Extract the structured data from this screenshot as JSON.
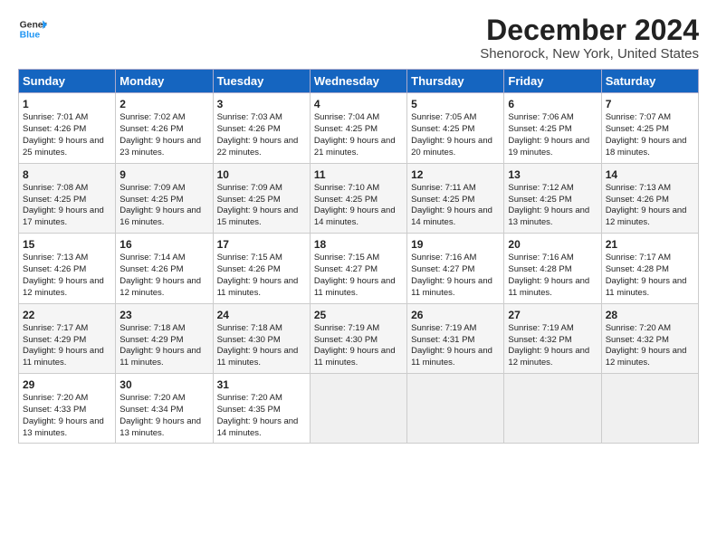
{
  "header": {
    "logo_line1": "General",
    "logo_line2": "Blue",
    "title": "December 2024",
    "subtitle": "Shenorock, New York, United States"
  },
  "days_of_week": [
    "Sunday",
    "Monday",
    "Tuesday",
    "Wednesday",
    "Thursday",
    "Friday",
    "Saturday"
  ],
  "weeks": [
    [
      {
        "day": 1,
        "sunrise": "Sunrise: 7:01 AM",
        "sunset": "Sunset: 4:26 PM",
        "daylight": "Daylight: 9 hours and 25 minutes."
      },
      {
        "day": 2,
        "sunrise": "Sunrise: 7:02 AM",
        "sunset": "Sunset: 4:26 PM",
        "daylight": "Daylight: 9 hours and 23 minutes."
      },
      {
        "day": 3,
        "sunrise": "Sunrise: 7:03 AM",
        "sunset": "Sunset: 4:26 PM",
        "daylight": "Daylight: 9 hours and 22 minutes."
      },
      {
        "day": 4,
        "sunrise": "Sunrise: 7:04 AM",
        "sunset": "Sunset: 4:25 PM",
        "daylight": "Daylight: 9 hours and 21 minutes."
      },
      {
        "day": 5,
        "sunrise": "Sunrise: 7:05 AM",
        "sunset": "Sunset: 4:25 PM",
        "daylight": "Daylight: 9 hours and 20 minutes."
      },
      {
        "day": 6,
        "sunrise": "Sunrise: 7:06 AM",
        "sunset": "Sunset: 4:25 PM",
        "daylight": "Daylight: 9 hours and 19 minutes."
      },
      {
        "day": 7,
        "sunrise": "Sunrise: 7:07 AM",
        "sunset": "Sunset: 4:25 PM",
        "daylight": "Daylight: 9 hours and 18 minutes."
      }
    ],
    [
      {
        "day": 8,
        "sunrise": "Sunrise: 7:08 AM",
        "sunset": "Sunset: 4:25 PM",
        "daylight": "Daylight: 9 hours and 17 minutes."
      },
      {
        "day": 9,
        "sunrise": "Sunrise: 7:09 AM",
        "sunset": "Sunset: 4:25 PM",
        "daylight": "Daylight: 9 hours and 16 minutes."
      },
      {
        "day": 10,
        "sunrise": "Sunrise: 7:09 AM",
        "sunset": "Sunset: 4:25 PM",
        "daylight": "Daylight: 9 hours and 15 minutes."
      },
      {
        "day": 11,
        "sunrise": "Sunrise: 7:10 AM",
        "sunset": "Sunset: 4:25 PM",
        "daylight": "Daylight: 9 hours and 14 minutes."
      },
      {
        "day": 12,
        "sunrise": "Sunrise: 7:11 AM",
        "sunset": "Sunset: 4:25 PM",
        "daylight": "Daylight: 9 hours and 14 minutes."
      },
      {
        "day": 13,
        "sunrise": "Sunrise: 7:12 AM",
        "sunset": "Sunset: 4:25 PM",
        "daylight": "Daylight: 9 hours and 13 minutes."
      },
      {
        "day": 14,
        "sunrise": "Sunrise: 7:13 AM",
        "sunset": "Sunset: 4:26 PM",
        "daylight": "Daylight: 9 hours and 12 minutes."
      }
    ],
    [
      {
        "day": 15,
        "sunrise": "Sunrise: 7:13 AM",
        "sunset": "Sunset: 4:26 PM",
        "daylight": "Daylight: 9 hours and 12 minutes."
      },
      {
        "day": 16,
        "sunrise": "Sunrise: 7:14 AM",
        "sunset": "Sunset: 4:26 PM",
        "daylight": "Daylight: 9 hours and 12 minutes."
      },
      {
        "day": 17,
        "sunrise": "Sunrise: 7:15 AM",
        "sunset": "Sunset: 4:26 PM",
        "daylight": "Daylight: 9 hours and 11 minutes."
      },
      {
        "day": 18,
        "sunrise": "Sunrise: 7:15 AM",
        "sunset": "Sunset: 4:27 PM",
        "daylight": "Daylight: 9 hours and 11 minutes."
      },
      {
        "day": 19,
        "sunrise": "Sunrise: 7:16 AM",
        "sunset": "Sunset: 4:27 PM",
        "daylight": "Daylight: 9 hours and 11 minutes."
      },
      {
        "day": 20,
        "sunrise": "Sunrise: 7:16 AM",
        "sunset": "Sunset: 4:28 PM",
        "daylight": "Daylight: 9 hours and 11 minutes."
      },
      {
        "day": 21,
        "sunrise": "Sunrise: 7:17 AM",
        "sunset": "Sunset: 4:28 PM",
        "daylight": "Daylight: 9 hours and 11 minutes."
      }
    ],
    [
      {
        "day": 22,
        "sunrise": "Sunrise: 7:17 AM",
        "sunset": "Sunset: 4:29 PM",
        "daylight": "Daylight: 9 hours and 11 minutes."
      },
      {
        "day": 23,
        "sunrise": "Sunrise: 7:18 AM",
        "sunset": "Sunset: 4:29 PM",
        "daylight": "Daylight: 9 hours and 11 minutes."
      },
      {
        "day": 24,
        "sunrise": "Sunrise: 7:18 AM",
        "sunset": "Sunset: 4:30 PM",
        "daylight": "Daylight: 9 hours and 11 minutes."
      },
      {
        "day": 25,
        "sunrise": "Sunrise: 7:19 AM",
        "sunset": "Sunset: 4:30 PM",
        "daylight": "Daylight: 9 hours and 11 minutes."
      },
      {
        "day": 26,
        "sunrise": "Sunrise: 7:19 AM",
        "sunset": "Sunset: 4:31 PM",
        "daylight": "Daylight: 9 hours and 11 minutes."
      },
      {
        "day": 27,
        "sunrise": "Sunrise: 7:19 AM",
        "sunset": "Sunset: 4:32 PM",
        "daylight": "Daylight: 9 hours and 12 minutes."
      },
      {
        "day": 28,
        "sunrise": "Sunrise: 7:20 AM",
        "sunset": "Sunset: 4:32 PM",
        "daylight": "Daylight: 9 hours and 12 minutes."
      }
    ],
    [
      {
        "day": 29,
        "sunrise": "Sunrise: 7:20 AM",
        "sunset": "Sunset: 4:33 PM",
        "daylight": "Daylight: 9 hours and 13 minutes."
      },
      {
        "day": 30,
        "sunrise": "Sunrise: 7:20 AM",
        "sunset": "Sunset: 4:34 PM",
        "daylight": "Daylight: 9 hours and 13 minutes."
      },
      {
        "day": 31,
        "sunrise": "Sunrise: 7:20 AM",
        "sunset": "Sunset: 4:35 PM",
        "daylight": "Daylight: 9 hours and 14 minutes."
      },
      null,
      null,
      null,
      null
    ]
  ]
}
